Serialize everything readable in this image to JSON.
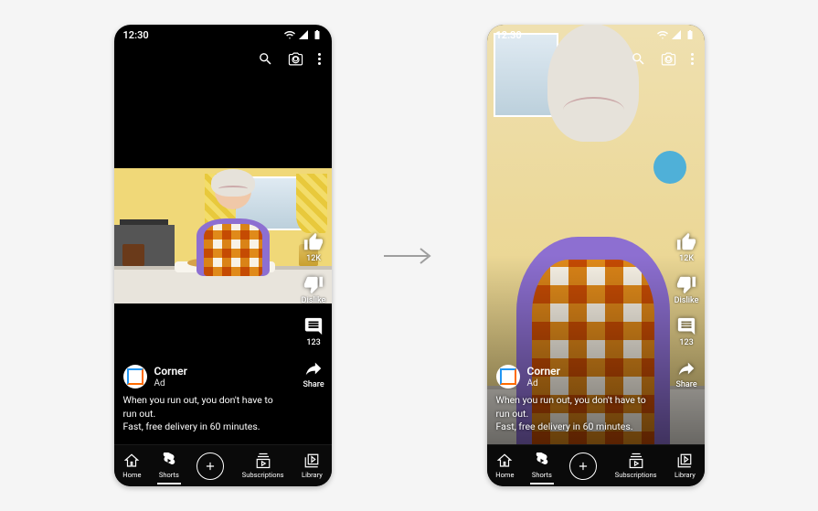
{
  "status": {
    "time": "12:30"
  },
  "rail": {
    "like_count": "12K",
    "dislike_label": "Dislike",
    "comments_count": "123",
    "share_label": "Share"
  },
  "ad": {
    "advertiser": "Corner",
    "label": "Ad",
    "caption_line1": "When you run out, you don't have to run out.",
    "caption_line2": "Fast, free delivery in 60 minutes."
  },
  "nav": {
    "home": "Home",
    "shorts": "Shorts",
    "subscriptions": "Subscriptions",
    "library": "Library"
  }
}
